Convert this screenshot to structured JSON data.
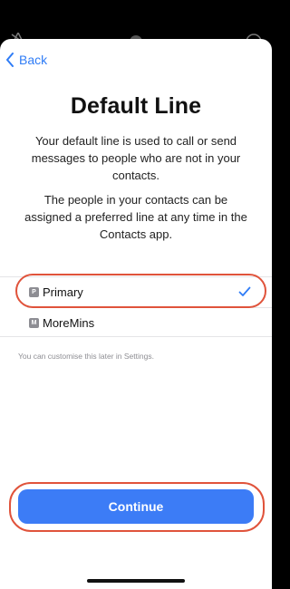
{
  "header": {
    "back_label": "Back"
  },
  "title": "Default Line",
  "description_1": "Your default line is used to call or send messages to people who are not in your contacts.",
  "description_2": "The people in your contacts can be assigned a preferred line at any time in the Contacts app.",
  "lines": [
    {
      "badge": "P",
      "label": "Primary",
      "selected": true
    },
    {
      "badge": "M",
      "label": "MoreMins",
      "selected": false
    }
  ],
  "hint": "You can customise this later in Settings.",
  "continue_label": "Continue",
  "colors": {
    "accent": "#3c7cf6",
    "annotation_ring": "#e0533b",
    "badge": "#8d8d93"
  },
  "icons": {
    "back": "chevron-left-icon",
    "selected": "checkmark-icon"
  }
}
